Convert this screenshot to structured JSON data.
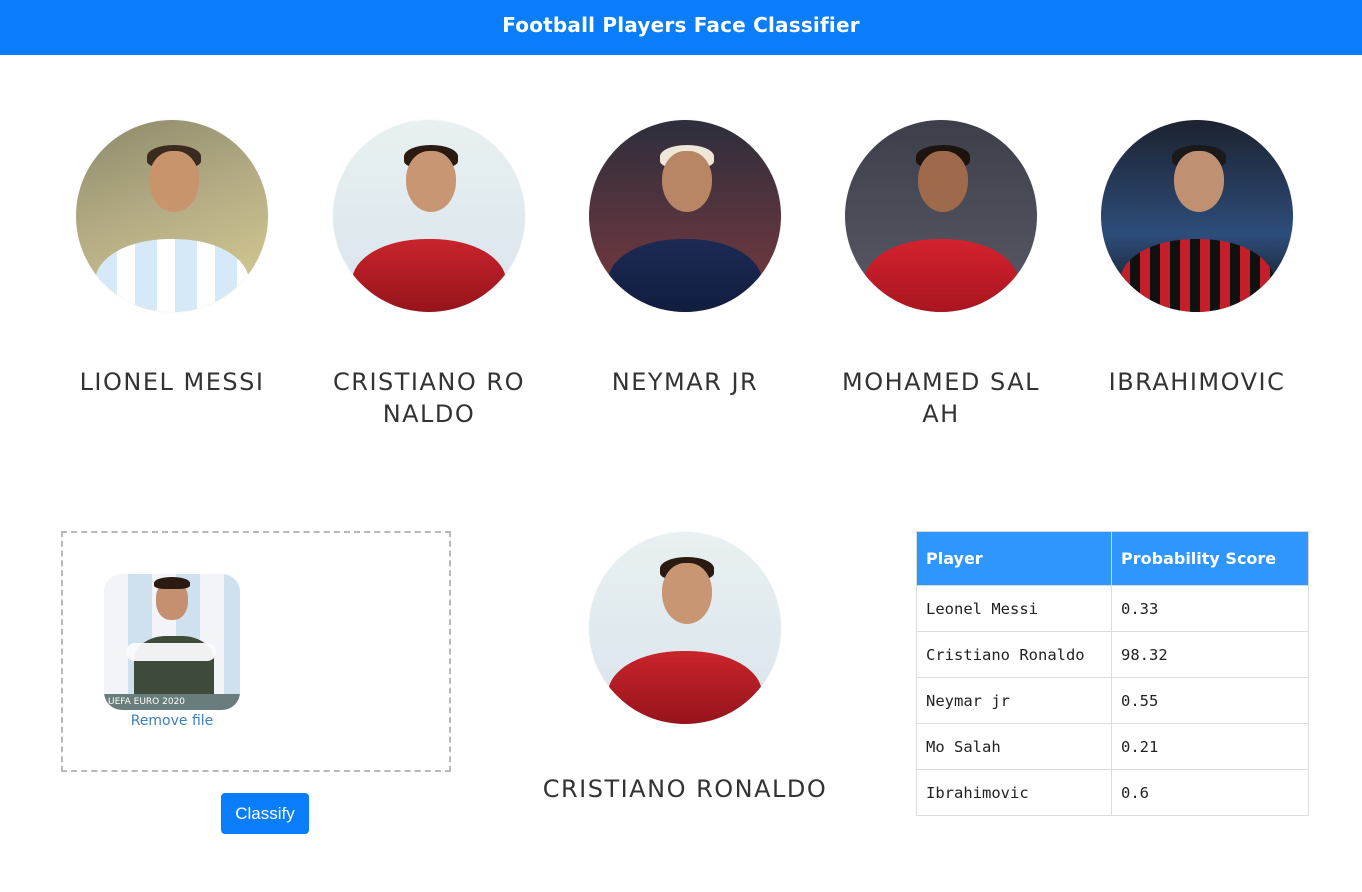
{
  "header": {
    "title": "Football Players Face Classifier"
  },
  "players": [
    {
      "name": "LIONEL MESSI"
    },
    {
      "name": "CRISTIANO RONALDO"
    },
    {
      "name": "NEYMAR JR"
    },
    {
      "name": "MOHAMED SALAH"
    },
    {
      "name": "IBRAHIMOVIC"
    }
  ],
  "upload": {
    "thumb_caption": "UEFA EURO 2020",
    "remove_label": "Remove file",
    "classify_label": "Classify"
  },
  "result": {
    "name": "CRISTIANO RONALDO"
  },
  "scores": {
    "headers": [
      "Player",
      "Probability Score"
    ],
    "rows": [
      {
        "player": "Leonel Messi",
        "score": "0.33"
      },
      {
        "player": "Cristiano Ronaldo",
        "score": "98.32"
      },
      {
        "player": "Neymar jr",
        "score": "0.55"
      },
      {
        "player": "Mo Salah",
        "score": "0.21"
      },
      {
        "player": "Ibrahimovic",
        "score": "0.6"
      }
    ]
  }
}
